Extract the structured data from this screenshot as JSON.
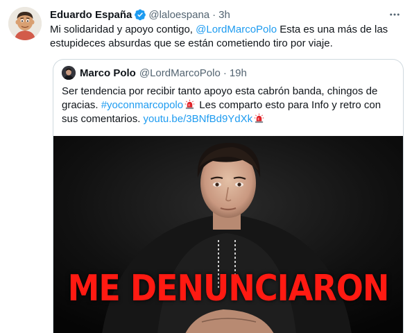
{
  "tweet": {
    "author_name": "Eduardo España",
    "author_handle": "@laloespana",
    "separator": "·",
    "time": "3h",
    "text_before_mention": "Mi solidaridad y apoyo contigo, ",
    "mention": "@LordMarcoPolo",
    "text_after_mention": " Esta es una más de las estupideces absurdas que se están cometiendo tiro por viaje.",
    "verified": true
  },
  "quoted_tweet": {
    "author_name": "Marco Polo",
    "author_handle": "@LordMarcoPolo",
    "separator": "·",
    "time": "19h",
    "text_part1": "Ser tendencia por recibir tanto apoyo esta cabrón banda, chingos de gracias. ",
    "hashtag": "#yoconmarcopolo",
    "text_part2": " Les comparto esto para Info y retro con sus comentarios. ",
    "link": "youtu.be/3BNfBd9YdXk",
    "media_caption": "ME DENUNCIARON"
  },
  "colors": {
    "link": "#1d9bf0",
    "muted": "#536471",
    "verified_badge": "#1d9bf0",
    "caption_red": "#ff1a12"
  },
  "icons": {
    "verified": "verified-badge-icon",
    "more": "more-dots-icon",
    "siren": "police-light-emoji"
  }
}
